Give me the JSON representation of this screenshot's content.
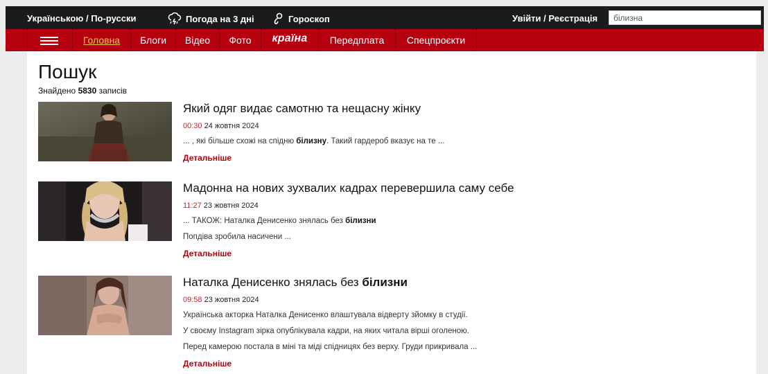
{
  "topbar": {
    "language": "Українською / По-русски",
    "weather": "Погода на 3 дні",
    "horoscope": "Гороскоп",
    "login": "Увійти / Реєстрація",
    "search_value": "білизна",
    "weather_icon": "cloud-lightning-icon",
    "horoscope_icon": "zodiac-icon"
  },
  "nav": {
    "menu_icon": "hamburger-menu-icon",
    "items": [
      {
        "label": "Головна",
        "active": true
      },
      {
        "label": "Блоги"
      },
      {
        "label": "Відео"
      },
      {
        "label": "Фото"
      },
      {
        "label": "країна",
        "brand": true
      },
      {
        "label": "Передплата"
      },
      {
        "label": "Спецпроєкти"
      }
    ]
  },
  "page": {
    "title": "Пошук",
    "found_prefix": "Знайдено ",
    "found_count": "5830",
    "found_suffix": " записів"
  },
  "results": [
    {
      "title_plain": "Який одяг видає самотню та нещасну жінку",
      "time": "00:30",
      "date": "24 жовтня 2024",
      "line1_pre": "... , які більше схожі на спідню ",
      "line1_bold": "білизну",
      "line1_post": ". Такий гардероб вказує на те ...",
      "more": "Детальніше"
    },
    {
      "title_plain": "Мадонна на нових зухвалих кадрах перевершила саму себе",
      "time": "11:27",
      "date": "23 жовтня 2024",
      "line1_pre": "... ТАКОЖ: Наталка Денисенко знялась без ",
      "line1_bold": "білизни",
      "line2": "Попдіва зробила насичени ...",
      "more": "Детальніше"
    },
    {
      "title_pre": "Наталка Денисенко знялась без ",
      "title_bold": "білизни",
      "time": "09:58",
      "date": "23 жовтня 2024",
      "line1": "Українська акторка Наталка Денисенко влаштувала відверту зйомку в студії.",
      "line2": "У своєму Instagram зірка опублікувала кадри, на яких читала вірші оголеною.",
      "line3": "Перед камерою постала в міні та міді спідницях без верху. Груди прикривала ...",
      "more": "Детальніше"
    }
  ],
  "colors": {
    "nav_red": "#b6000f",
    "topbar_dark": "#1b1b1b",
    "active_link": "#f3c64a",
    "time_red": "#c0262d"
  }
}
